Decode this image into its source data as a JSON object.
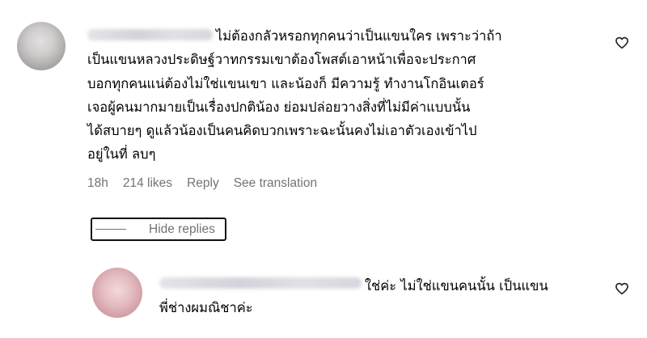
{
  "comments": [
    {
      "avatar_icon": "user-avatar-gray",
      "lines": [
        "ไม่ต้องกลัวหรอกทุกคนว่าเป็นแขนใคร เพราะว่าถ้า",
        "เป็นแขนหลวงประดิษฐ์วาทกรรมเขาต้องโพสต์เอาหน้าเพื่อจะประกาศ",
        "บอกทุกคนแน่ต้องไม่ใช่แขนเขา และน้องก็ มีความรู้ ทำงานโกอินเตอร์",
        "เจอผู้คนมากมายเป็นเรื่องปกติน้อง ย่อมปล่อยวางสิ่งที่ไม่มีค่าแบบนั้น",
        "ได้สบายๆ ดูแล้วน้องเป็นคนคิดบวกเพราะฉะนั้นคงไม่เอาตัวเองเข้าไป",
        "อยู่ในที่ ลบๆ"
      ],
      "time": "18h",
      "likes": "214 likes",
      "reply_label": "Reply",
      "translate_label": "See translation",
      "like_icon": "heart-outline-icon"
    },
    {
      "avatar_icon": "user-avatar-pink",
      "lines": [
        "ใช่ค่ะ ไม่ใช่แขนคนนั้น เป็นแขน",
        "พี่ช่างผมณิชาค่ะ"
      ],
      "like_icon": "heart-outline-icon"
    }
  ],
  "hide_replies_label": "Hide replies",
  "colors": {
    "meta_text": "#737373",
    "body_text": "#000000",
    "background": "#ffffff"
  }
}
